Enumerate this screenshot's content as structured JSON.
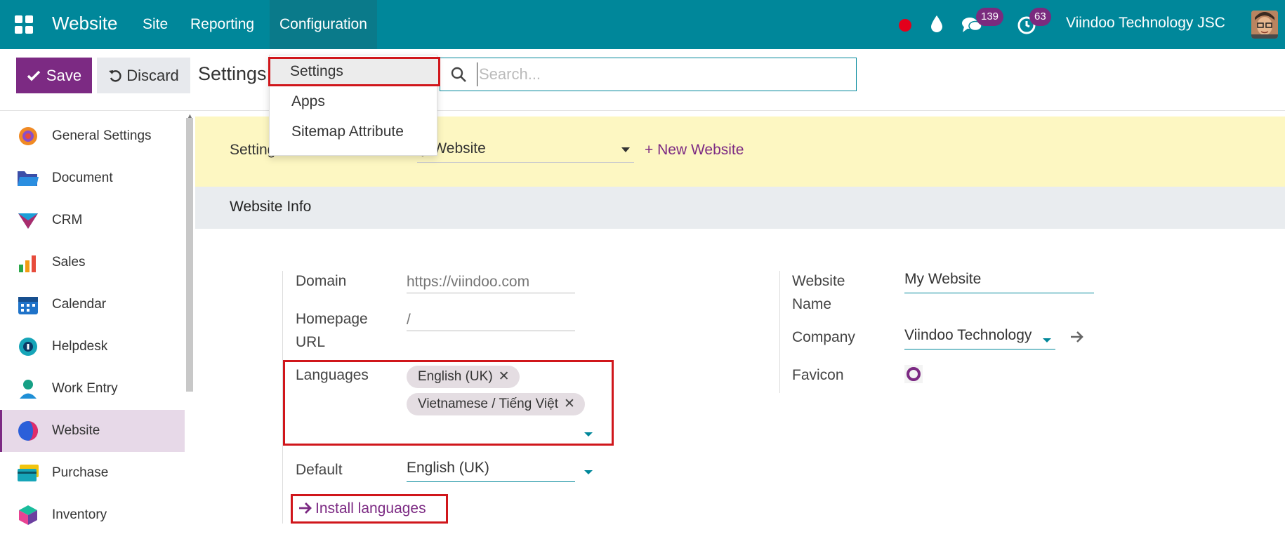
{
  "navbar": {
    "app_name": "Website",
    "menus": [
      "Site",
      "Reporting",
      "Configuration"
    ],
    "messages_count": "139",
    "activities_count": "63",
    "company": "Viindoo Technology JSC"
  },
  "control": {
    "save_label": "Save",
    "discard_label": "Discard",
    "title": "Settings",
    "search_placeholder": "Search..."
  },
  "config_menu": {
    "items": [
      "Settings",
      "Apps",
      "Sitemap Attribute"
    ]
  },
  "sidebar": {
    "items": [
      {
        "label": "General Settings",
        "icon": "general-settings-icon"
      },
      {
        "label": "Document",
        "icon": "folder-icon"
      },
      {
        "label": "CRM",
        "icon": "crm-icon"
      },
      {
        "label": "Sales",
        "icon": "sales-chart-icon"
      },
      {
        "label": "Calendar",
        "icon": "calendar-icon"
      },
      {
        "label": "Helpdesk",
        "icon": "headset-icon"
      },
      {
        "label": "Work Entry",
        "icon": "work-entry-icon"
      },
      {
        "label": "Website",
        "icon": "website-icon"
      },
      {
        "label": "Purchase",
        "icon": "credit-card-icon"
      },
      {
        "label": "Inventory",
        "icon": "box-icon"
      }
    ],
    "active": "Website"
  },
  "banner": {
    "label": "Setting",
    "website_select": "y Website",
    "new_website": "+ New Website"
  },
  "section": {
    "title": "Website Info"
  },
  "form_left": {
    "domain_label": "Domain",
    "domain_placeholder": "https://viindoo.com",
    "homepage_label_1": "Homepage",
    "homepage_label_2": "URL",
    "homepage_placeholder": "/",
    "languages_label": "Languages",
    "languages": [
      "English (UK)",
      "Vietnamese / Tiếng Việt"
    ],
    "default_label": "Default",
    "default_value": "English (UK)",
    "install_languages": "Install languages"
  },
  "form_right": {
    "website_name_label_1": "Website",
    "website_name_label_2": "Name",
    "website_name_value": "My Website",
    "company_label": "Company",
    "company_value": "Viindoo Technology",
    "favicon_label": "Favicon"
  },
  "colors": {
    "navbar": "#00879a",
    "primary": "#7c2a83",
    "highlight": "#d0161b",
    "banner": "#fdf7c2"
  }
}
